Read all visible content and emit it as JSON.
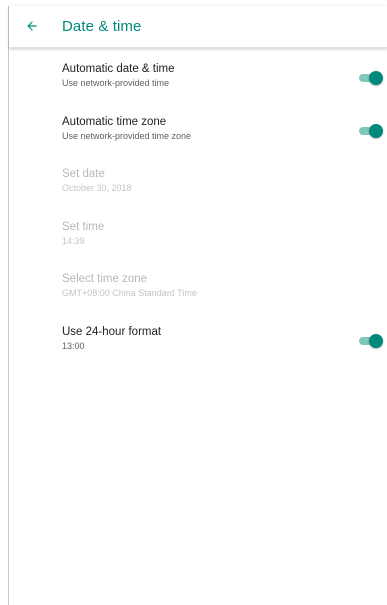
{
  "app_bar": {
    "title": "Date & time",
    "back_icon": "arrow-back-icon"
  },
  "settings": [
    {
      "title": "Automatic date & time",
      "summary": "Use network-provided time",
      "enabled": true,
      "switch_on": true
    },
    {
      "title": "Automatic time zone",
      "summary": "Use network-provided time zone",
      "enabled": true,
      "switch_on": true
    },
    {
      "title": "Set date",
      "summary": "October 30, 2018",
      "enabled": false
    },
    {
      "title": "Set time",
      "summary": "14:39",
      "enabled": false
    },
    {
      "title": "Select time zone",
      "summary": "GMT+08:00 China Standard Time",
      "enabled": false
    },
    {
      "title": "Use 24-hour format",
      "summary": "13:00",
      "enabled": true,
      "switch_on": true
    }
  ],
  "colors": {
    "accent": "#00897b",
    "switch_track": "#80c6bd",
    "primary_text": "#212121",
    "secondary_text": "#5f5f5f",
    "disabled_text": "#b8b8b8"
  }
}
